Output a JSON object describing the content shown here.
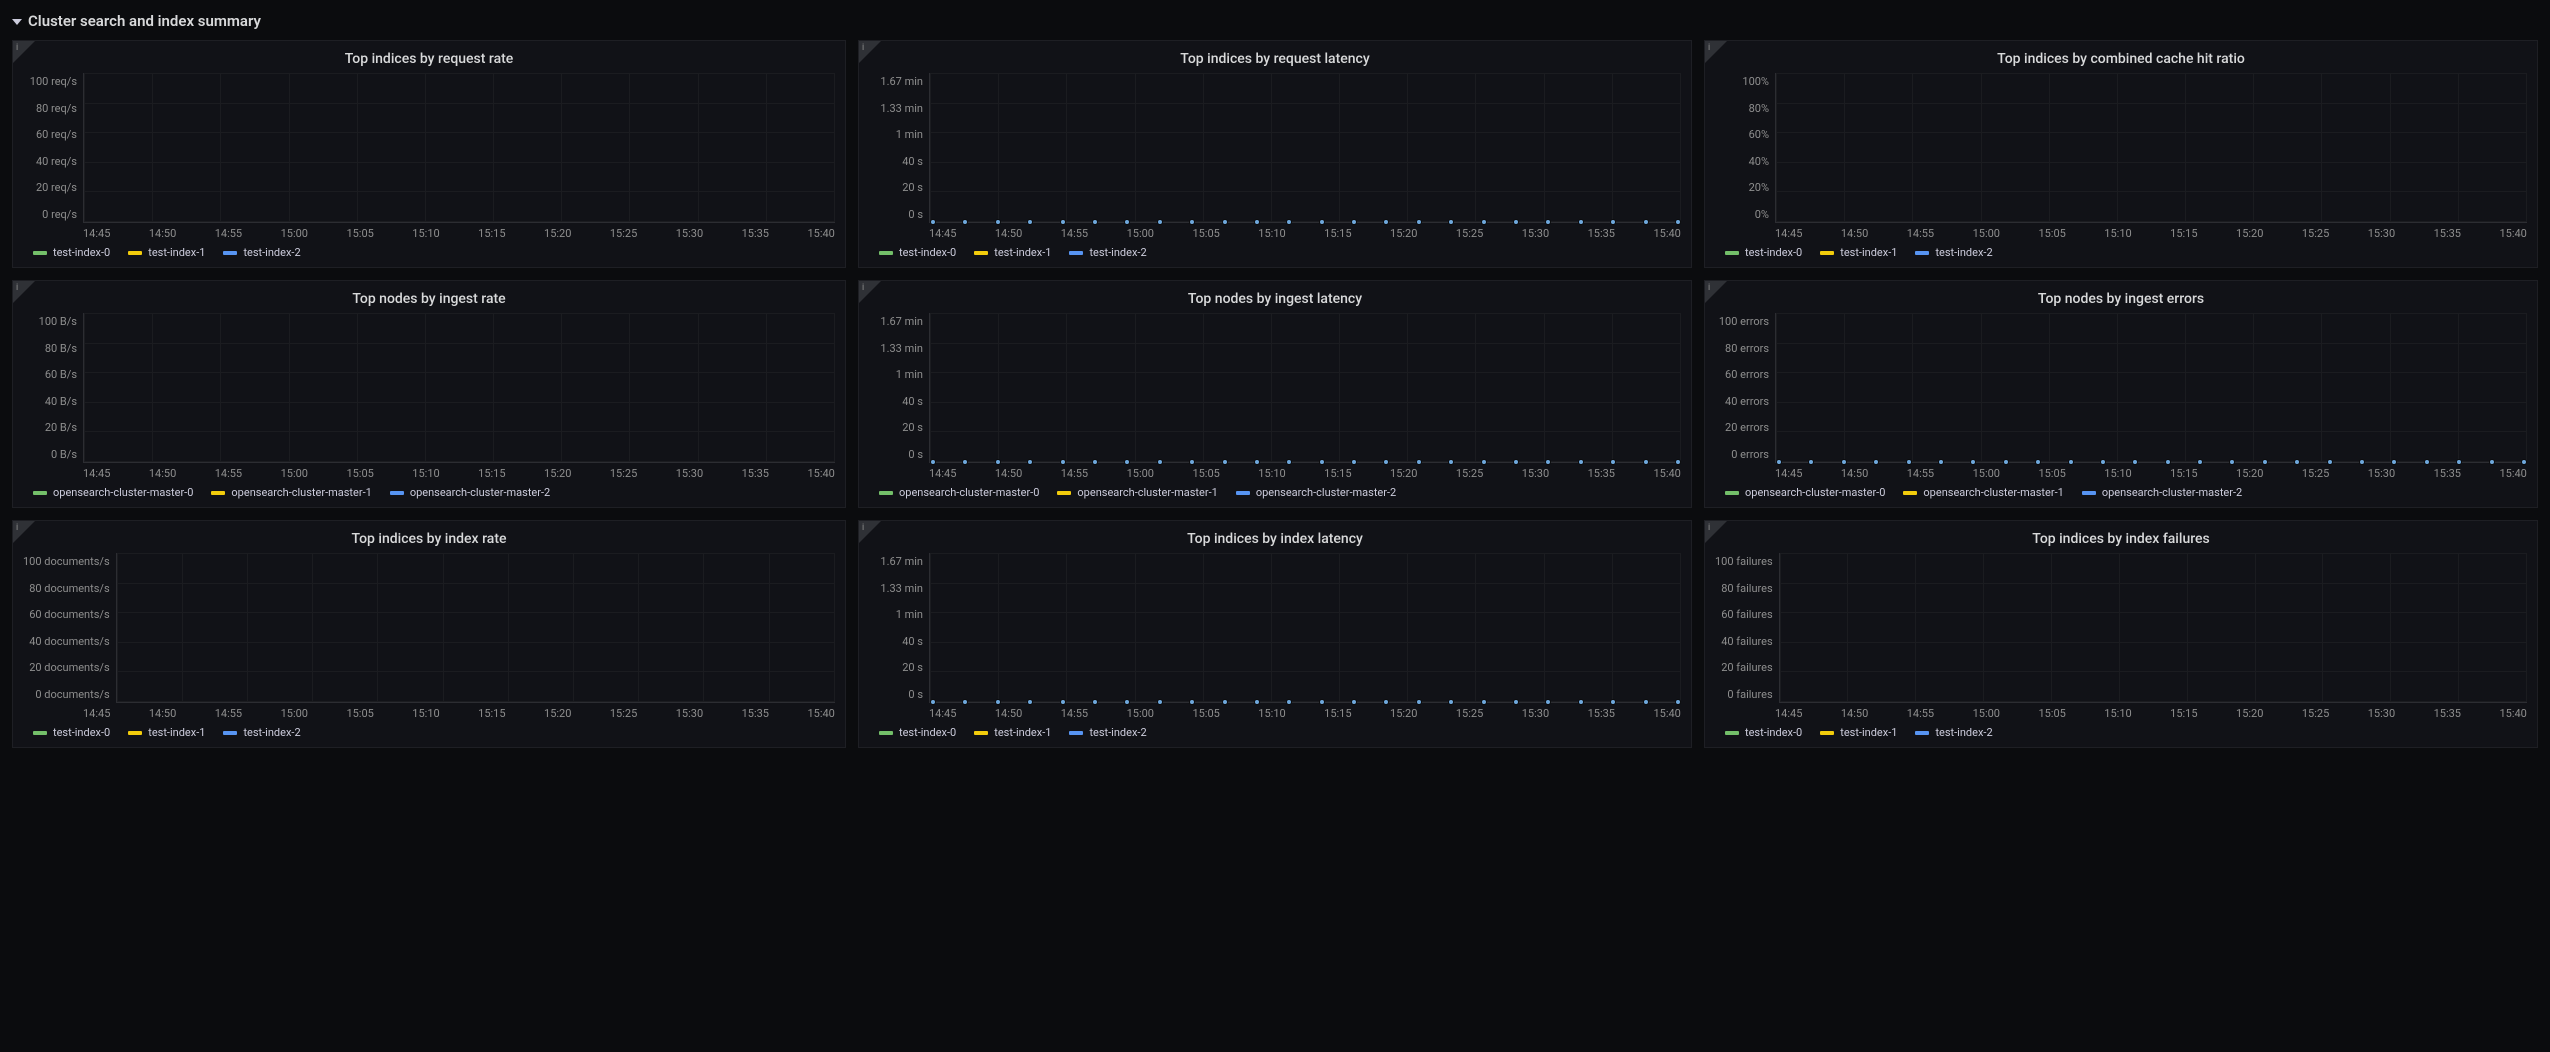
{
  "header": {
    "title": "Cluster search and index summary"
  },
  "xticks": [
    "14:45",
    "14:50",
    "14:55",
    "15:00",
    "15:05",
    "15:10",
    "15:15",
    "15:20",
    "15:25",
    "15:30",
    "15:35",
    "15:40"
  ],
  "legends": {
    "indices": [
      "test-index-0",
      "test-index-1",
      "test-index-2"
    ],
    "nodes": [
      "opensearch-cluster-master-0",
      "opensearch-cluster-master-1",
      "opensearch-cluster-master-2"
    ]
  },
  "colors": {
    "series0": "#73bf69",
    "series1": "#f2cc0c",
    "series2": "#5794f2"
  },
  "panels": [
    {
      "id": "p1",
      "title": "Top indices by request rate",
      "legend": "indices",
      "yticks": [
        "100 req/s",
        "80 req/s",
        "60 req/s",
        "40 req/s",
        "20 req/s",
        "0 req/s"
      ],
      "dots": false
    },
    {
      "id": "p2",
      "title": "Top indices by request latency",
      "legend": "indices",
      "yticks": [
        "1.67 min",
        "1.33 min",
        "1 min",
        "40 s",
        "20 s",
        "0 s"
      ],
      "dots": true
    },
    {
      "id": "p3",
      "title": "Top indices by combined cache hit ratio",
      "legend": "indices",
      "yticks": [
        "100%",
        "80%",
        "60%",
        "40%",
        "20%",
        "0%"
      ],
      "dots": false
    },
    {
      "id": "p4",
      "title": "Top nodes by ingest rate",
      "legend": "nodes",
      "yticks": [
        "100 B/s",
        "80 B/s",
        "60 B/s",
        "40 B/s",
        "20 B/s",
        "0 B/s"
      ],
      "dots": false
    },
    {
      "id": "p5",
      "title": "Top nodes by ingest latency",
      "legend": "nodes",
      "yticks": [
        "1.67 min",
        "1.33 min",
        "1 min",
        "40 s",
        "20 s",
        "0 s"
      ],
      "dots": true
    },
    {
      "id": "p6",
      "title": "Top nodes by ingest errors",
      "legend": "nodes",
      "yticks": [
        "100 errors",
        "80 errors",
        "60 errors",
        "40 errors",
        "20 errors",
        "0 errors"
      ],
      "dots": true
    },
    {
      "id": "p7",
      "title": "Top indices by index rate",
      "legend": "indices",
      "yticks": [
        "100 documents/s",
        "80 documents/s",
        "60 documents/s",
        "40 documents/s",
        "20 documents/s",
        "0 documents/s"
      ],
      "dots": false
    },
    {
      "id": "p8",
      "title": "Top indices by index latency",
      "legend": "indices",
      "yticks": [
        "1.67 min",
        "1.33 min",
        "1 min",
        "40 s",
        "20 s",
        "0 s"
      ],
      "dots": true
    },
    {
      "id": "p9",
      "title": "Top indices by index failures",
      "legend": "indices",
      "yticks": [
        "100 failures",
        "80 failures",
        "60 failures",
        "40 failures",
        "20 failures",
        "0 failures"
      ],
      "dots": false
    }
  ],
  "chart_data": [
    {
      "id": "p1",
      "type": "line",
      "title": "Top indices by request rate",
      "xlabel": "",
      "ylabel": "req/s",
      "ylim": [
        0,
        100
      ],
      "x": [
        "14:45",
        "14:50",
        "14:55",
        "15:00",
        "15:05",
        "15:10",
        "15:15",
        "15:20",
        "15:25",
        "15:30",
        "15:35",
        "15:40"
      ],
      "series": [
        {
          "name": "test-index-0",
          "values": [
            0,
            0,
            0,
            0,
            0,
            0,
            0,
            0,
            0,
            0,
            0,
            0
          ]
        },
        {
          "name": "test-index-1",
          "values": [
            0,
            0,
            0,
            0,
            0,
            0,
            0,
            0,
            0,
            0,
            0,
            0
          ]
        },
        {
          "name": "test-index-2",
          "values": [
            0,
            0,
            0,
            0,
            0,
            0,
            0,
            0,
            0,
            0,
            0,
            0
          ]
        }
      ]
    },
    {
      "id": "p2",
      "type": "line",
      "title": "Top indices by request latency",
      "xlabel": "",
      "ylabel": "seconds",
      "ylim": [
        0,
        100
      ],
      "x": [
        "14:45",
        "14:50",
        "14:55",
        "15:00",
        "15:05",
        "15:10",
        "15:15",
        "15:20",
        "15:25",
        "15:30",
        "15:35",
        "15:40"
      ],
      "series": [
        {
          "name": "test-index-0",
          "values": [
            0,
            0,
            0,
            0,
            0,
            0,
            0,
            0,
            0,
            0,
            0,
            0
          ]
        },
        {
          "name": "test-index-1",
          "values": [
            0,
            0,
            0,
            0,
            0,
            0,
            0,
            0,
            0,
            0,
            0,
            0
          ]
        },
        {
          "name": "test-index-2",
          "values": [
            0,
            0,
            0,
            0,
            0,
            0,
            0,
            0,
            0,
            0,
            0,
            0
          ]
        }
      ]
    },
    {
      "id": "p3",
      "type": "line",
      "title": "Top indices by combined cache hit ratio",
      "xlabel": "",
      "ylabel": "%",
      "ylim": [
        0,
        100
      ],
      "x": [
        "14:45",
        "14:50",
        "14:55",
        "15:00",
        "15:05",
        "15:10",
        "15:15",
        "15:20",
        "15:25",
        "15:30",
        "15:35",
        "15:40"
      ],
      "series": [
        {
          "name": "test-index-0",
          "values": [
            0,
            0,
            0,
            0,
            0,
            0,
            0,
            0,
            0,
            0,
            0,
            0
          ]
        },
        {
          "name": "test-index-1",
          "values": [
            0,
            0,
            0,
            0,
            0,
            0,
            0,
            0,
            0,
            0,
            0,
            0
          ]
        },
        {
          "name": "test-index-2",
          "values": [
            0,
            0,
            0,
            0,
            0,
            0,
            0,
            0,
            0,
            0,
            0,
            0
          ]
        }
      ]
    },
    {
      "id": "p4",
      "type": "line",
      "title": "Top nodes by ingest rate",
      "xlabel": "",
      "ylabel": "B/s",
      "ylim": [
        0,
        100
      ],
      "x": [
        "14:45",
        "14:50",
        "14:55",
        "15:00",
        "15:05",
        "15:10",
        "15:15",
        "15:20",
        "15:25",
        "15:30",
        "15:35",
        "15:40"
      ],
      "series": [
        {
          "name": "opensearch-cluster-master-0",
          "values": [
            0,
            0,
            0,
            0,
            0,
            0,
            0,
            0,
            0,
            0,
            0,
            0
          ]
        },
        {
          "name": "opensearch-cluster-master-1",
          "values": [
            0,
            0,
            0,
            0,
            0,
            0,
            0,
            0,
            0,
            0,
            0,
            0
          ]
        },
        {
          "name": "opensearch-cluster-master-2",
          "values": [
            0,
            0,
            0,
            0,
            0,
            0,
            0,
            0,
            0,
            0,
            0,
            0
          ]
        }
      ]
    },
    {
      "id": "p5",
      "type": "line",
      "title": "Top nodes by ingest latency",
      "xlabel": "",
      "ylabel": "seconds",
      "ylim": [
        0,
        100
      ],
      "x": [
        "14:45",
        "14:50",
        "14:55",
        "15:00",
        "15:05",
        "15:10",
        "15:15",
        "15:20",
        "15:25",
        "15:30",
        "15:35",
        "15:40"
      ],
      "series": [
        {
          "name": "opensearch-cluster-master-0",
          "values": [
            0,
            0,
            0,
            0,
            0,
            0,
            0,
            0,
            0,
            0,
            0,
            0
          ]
        },
        {
          "name": "opensearch-cluster-master-1",
          "values": [
            0,
            0,
            0,
            0,
            0,
            0,
            0,
            0,
            0,
            0,
            0,
            0
          ]
        },
        {
          "name": "opensearch-cluster-master-2",
          "values": [
            0,
            0,
            0,
            0,
            0,
            0,
            0,
            0,
            0,
            0,
            0,
            0
          ]
        }
      ]
    },
    {
      "id": "p6",
      "type": "line",
      "title": "Top nodes by ingest errors",
      "xlabel": "",
      "ylabel": "errors",
      "ylim": [
        0,
        100
      ],
      "x": [
        "14:45",
        "14:50",
        "14:55",
        "15:00",
        "15:05",
        "15:10",
        "15:15",
        "15:20",
        "15:25",
        "15:30",
        "15:35",
        "15:40"
      ],
      "series": [
        {
          "name": "opensearch-cluster-master-0",
          "values": [
            0,
            0,
            0,
            0,
            0,
            0,
            0,
            0,
            0,
            0,
            0,
            0
          ]
        },
        {
          "name": "opensearch-cluster-master-1",
          "values": [
            0,
            0,
            0,
            0,
            0,
            0,
            0,
            0,
            0,
            0,
            0,
            0
          ]
        },
        {
          "name": "opensearch-cluster-master-2",
          "values": [
            0,
            0,
            0,
            0,
            0,
            0,
            0,
            0,
            0,
            0,
            0,
            0
          ]
        }
      ]
    },
    {
      "id": "p7",
      "type": "line",
      "title": "Top indices by index rate",
      "xlabel": "",
      "ylabel": "documents/s",
      "ylim": [
        0,
        100
      ],
      "x": [
        "14:45",
        "14:50",
        "14:55",
        "15:00",
        "15:05",
        "15:10",
        "15:15",
        "15:20",
        "15:25",
        "15:30",
        "15:35",
        "15:40"
      ],
      "series": [
        {
          "name": "test-index-0",
          "values": [
            0,
            0,
            0,
            0,
            0,
            0,
            0,
            0,
            0,
            0,
            0,
            0
          ]
        },
        {
          "name": "test-index-1",
          "values": [
            0,
            0,
            0,
            0,
            0,
            0,
            0,
            0,
            0,
            0,
            0,
            0
          ]
        },
        {
          "name": "test-index-2",
          "values": [
            0,
            0,
            0,
            0,
            0,
            0,
            0,
            0,
            0,
            0,
            0,
            0
          ]
        }
      ]
    },
    {
      "id": "p8",
      "type": "line",
      "title": "Top indices by index latency",
      "xlabel": "",
      "ylabel": "seconds",
      "ylim": [
        0,
        100
      ],
      "x": [
        "14:45",
        "14:50",
        "14:55",
        "15:00",
        "15:05",
        "15:10",
        "15:15",
        "15:20",
        "15:25",
        "15:30",
        "15:35",
        "15:40"
      ],
      "series": [
        {
          "name": "test-index-0",
          "values": [
            0,
            0,
            0,
            0,
            0,
            0,
            0,
            0,
            0,
            0,
            0,
            0
          ]
        },
        {
          "name": "test-index-1",
          "values": [
            0,
            0,
            0,
            0,
            0,
            0,
            0,
            0,
            0,
            0,
            0,
            0
          ]
        },
        {
          "name": "test-index-2",
          "values": [
            0,
            0,
            0,
            0,
            0,
            0,
            0,
            0,
            0,
            0,
            0,
            0
          ]
        }
      ]
    },
    {
      "id": "p9",
      "type": "line",
      "title": "Top indices by index failures",
      "xlabel": "",
      "ylabel": "failures",
      "ylim": [
        0,
        100
      ],
      "x": [
        "14:45",
        "14:50",
        "14:55",
        "15:00",
        "15:05",
        "15:10",
        "15:15",
        "15:20",
        "15:25",
        "15:30",
        "15:35",
        "15:40"
      ],
      "series": [
        {
          "name": "test-index-0",
          "values": [
            0,
            0,
            0,
            0,
            0,
            0,
            0,
            0,
            0,
            0,
            0,
            0
          ]
        },
        {
          "name": "test-index-1",
          "values": [
            0,
            0,
            0,
            0,
            0,
            0,
            0,
            0,
            0,
            0,
            0,
            0
          ]
        },
        {
          "name": "test-index-2",
          "values": [
            0,
            0,
            0,
            0,
            0,
            0,
            0,
            0,
            0,
            0,
            0,
            0
          ]
        }
      ]
    }
  ]
}
